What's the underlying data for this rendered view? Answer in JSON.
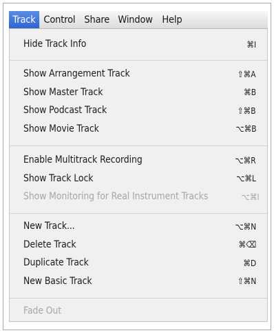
{
  "menubar": {
    "items": [
      "Track",
      "Control",
      "Share",
      "Window",
      "Help"
    ]
  },
  "menu": {
    "group1": [
      {
        "label": "Hide Track Info",
        "shortcut": "⌘I"
      }
    ],
    "group2": [
      {
        "label": "Show Arrangement Track",
        "shortcut": "⇧⌘A"
      },
      {
        "label": "Show Master Track",
        "shortcut": "⌘B"
      },
      {
        "label": "Show Podcast Track",
        "shortcut": "⇧⌘B"
      },
      {
        "label": "Show Movie Track",
        "shortcut": "⌥⌘B"
      }
    ],
    "group3": [
      {
        "label": "Enable Multitrack Recording",
        "shortcut": "⌥⌘R"
      },
      {
        "label": "Show Track Lock",
        "shortcut": "⌥⌘L"
      },
      {
        "label": "Show Monitoring for Real Instrument Tracks",
        "shortcut": "⌥⌘I"
      }
    ],
    "group4": [
      {
        "label": "New Track...",
        "shortcut": "⌥⌘N"
      },
      {
        "label": "Delete Track",
        "shortcut": "⌘⌫"
      },
      {
        "label": "Duplicate Track",
        "shortcut": "⌘D"
      },
      {
        "label": "New Basic Track",
        "shortcut": "⇧⌘N"
      }
    ],
    "group5": [
      {
        "label": "Fade Out",
        "shortcut": ""
      }
    ]
  }
}
